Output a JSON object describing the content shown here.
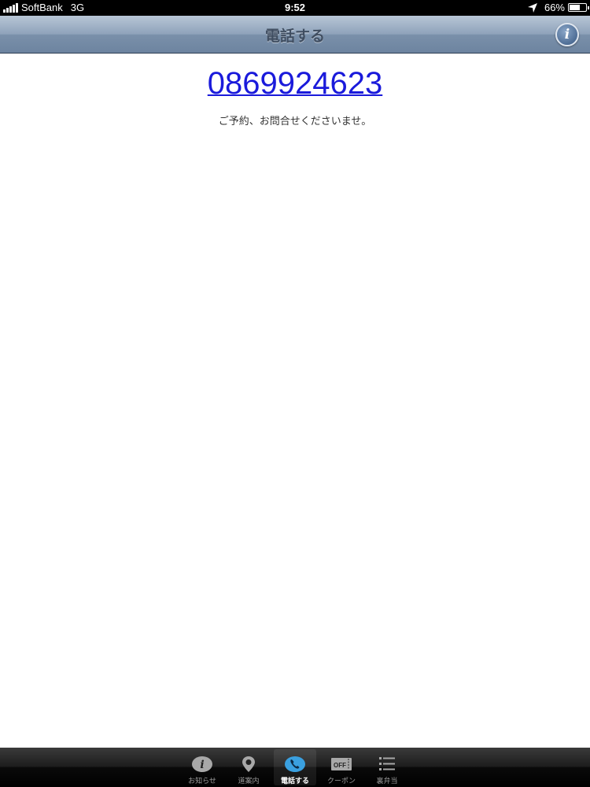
{
  "status_bar": {
    "carrier": "SoftBank",
    "network": "3G",
    "time": "9:52",
    "battery": "66%",
    "battery_level": 0.66
  },
  "nav_bar": {
    "title": "電話する",
    "info_icon": "info-icon"
  },
  "content": {
    "phone_number": "0869924623",
    "message": "ご予約、お問合せくださいませ。"
  },
  "tab_bar": {
    "tabs": [
      {
        "label": "お知らせ",
        "icon": "info-icon",
        "active": false
      },
      {
        "label": "道案内",
        "icon": "map-pin-icon",
        "active": false
      },
      {
        "label": "電話する",
        "icon": "phone-icon",
        "active": true
      },
      {
        "label": "クーポン",
        "icon": "coupon-icon",
        "active": false
      },
      {
        "label": "裏弁当",
        "icon": "list-icon",
        "active": false
      }
    ]
  },
  "colors": {
    "link": "#1a1adb",
    "nav_title": "#3f4d60",
    "tab_active_icon": "#3aa0e0"
  }
}
